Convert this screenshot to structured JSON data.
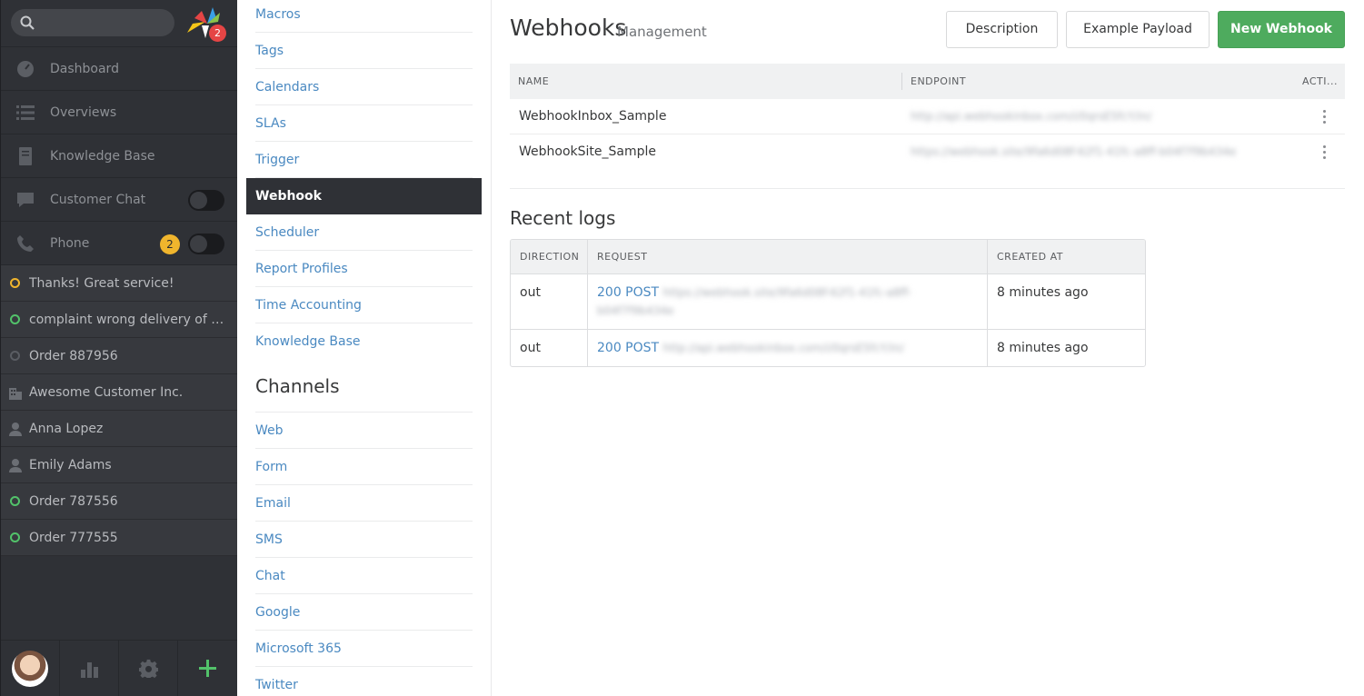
{
  "nav": {
    "logo_badge": "2",
    "items": [
      {
        "label": "Dashboard",
        "icon": "dashboard-icon"
      },
      {
        "label": "Overviews",
        "icon": "list-icon"
      },
      {
        "label": "Knowledge Base",
        "icon": "book-icon"
      },
      {
        "label": "Customer Chat",
        "icon": "chat-icon",
        "toggle": "off"
      },
      {
        "label": "Phone",
        "icon": "phone-icon",
        "badge": "2",
        "toggle": "off"
      }
    ],
    "tasks": [
      {
        "label": "Thanks! Great service!",
        "icon": "ticket-open-icon",
        "status_color": "#f0b52d"
      },
      {
        "label": "complaint wrong delivery of order",
        "icon": "ticket-open-icon",
        "status_color": "#52c26a"
      },
      {
        "label": "Order 887956",
        "icon": "ticket-closed-icon",
        "status_color": "#5a5d63"
      },
      {
        "label": "Awesome Customer Inc.",
        "icon": "organization-icon"
      },
      {
        "label": "Anna Lopez",
        "icon": "user-icon"
      },
      {
        "label": "Emily Adams",
        "icon": "user-icon"
      },
      {
        "label": "Order 787556",
        "icon": "ticket-open-icon",
        "status_color": "#52c26a"
      },
      {
        "label": "Order 777555",
        "icon": "ticket-open-icon",
        "status_color": "#52c26a"
      }
    ],
    "bottom": [
      "avatar",
      "stats-icon",
      "gear-icon",
      "plus-icon"
    ]
  },
  "settings": {
    "items": [
      "Macros",
      "Tags",
      "Calendars",
      "SLAs",
      "Trigger",
      "Webhook",
      "Scheduler",
      "Report Profiles",
      "Time Accounting",
      "Knowledge Base"
    ],
    "active": "Webhook",
    "channels_heading": "Channels",
    "channels": [
      "Web",
      "Form",
      "Email",
      "SMS",
      "Chat",
      "Google",
      "Microsoft 365",
      "Twitter"
    ]
  },
  "main": {
    "title": "Webhooks",
    "subtitle": "Management",
    "buttons": {
      "description": "Description",
      "example_payload": "Example Payload",
      "new_webhook": "New Webhook"
    },
    "webhooks": {
      "columns": [
        "NAME",
        "ENDPOINT",
        "ACTI..."
      ],
      "rows": [
        {
          "name": "WebhookInbox_Sample",
          "endpoint": "http://api.webhookinbox.com/i/0qrsE5fcY/in/"
        },
        {
          "name": "WebhookSite_Sample",
          "endpoint": "https://webhook.site/9fa6d08f-62f1-41fc-a8ff-b04f7f9b434e"
        }
      ]
    },
    "logs_title": "Recent logs",
    "logs": {
      "columns": [
        "DIRECTION",
        "REQUEST",
        "CREATED AT"
      ],
      "rows": [
        {
          "direction": "out",
          "status": "200 POST",
          "url": "https://webhook.site/9fa6d08f-62f1-41fc-a8ff-b04f7f9b434e",
          "created": "8 minutes ago"
        },
        {
          "direction": "out",
          "status": "200 POST",
          "url": "http://api.webhookinbox.com/i/0qrsE5fcY/in/",
          "created": "8 minutes ago"
        }
      ]
    }
  },
  "colors": {
    "accent": "#4a89c1",
    "primary_button": "#4eab5e",
    "nav_bg": "#2f3136"
  }
}
